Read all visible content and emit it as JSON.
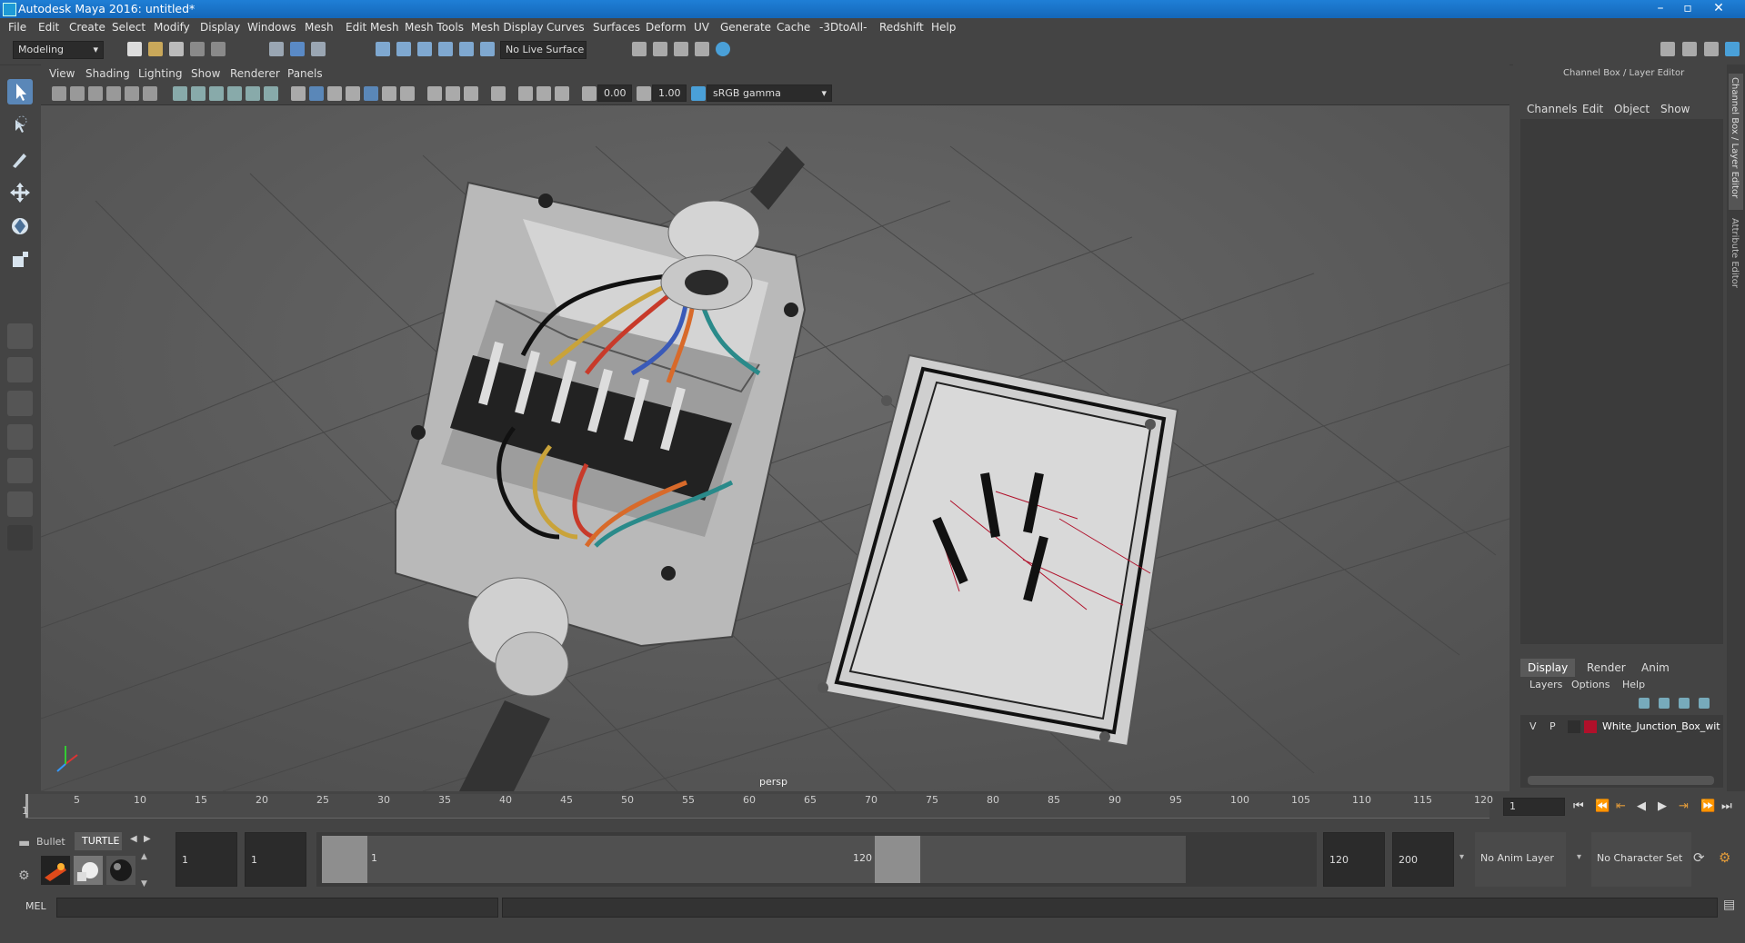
{
  "window": {
    "title": "Autodesk Maya 2016: untitled*"
  },
  "menubar": [
    "File",
    "Edit",
    "Create",
    "Select",
    "Modify",
    "Display",
    "Windows",
    "Mesh",
    "Edit Mesh",
    "Mesh Tools",
    "Mesh Display",
    "Curves",
    "Surfaces",
    "Deform",
    "UV",
    "Generate",
    "Cache",
    "-3DtoAll-",
    "Redshift",
    "Help"
  ],
  "shelf": {
    "mode": "Modeling",
    "live_surface": "No Live Surface"
  },
  "viewport": {
    "menu": [
      "View",
      "Shading",
      "Lighting",
      "Show",
      "Renderer",
      "Panels"
    ],
    "exposure": "0.00",
    "gamma": "1.00",
    "color_space": "sRGB gamma",
    "camera_label": "persp"
  },
  "channel_box": {
    "header": "Channel Box / Layer Editor",
    "menu": [
      "Channels",
      "Edit",
      "Object",
      "Show"
    ],
    "side_tabs": [
      "Channel Box / Layer Editor",
      "Attribute Editor"
    ]
  },
  "layer_editor": {
    "tabs": [
      "Display",
      "Render",
      "Anim"
    ],
    "menu": [
      "Layers",
      "Options",
      "Help"
    ],
    "layer": {
      "visible": "V",
      "playback": "P",
      "name": "White_Junction_Box_wit",
      "color": "#b0102a"
    }
  },
  "timeline": {
    "ticks": [
      "5",
      "10",
      "15",
      "20",
      "25",
      "30",
      "35",
      "40",
      "45",
      "50",
      "55",
      "60",
      "65",
      "70",
      "75",
      "80",
      "85",
      "90",
      "95",
      "100",
      "105",
      "110",
      "115",
      "120"
    ],
    "start_tick": "1",
    "current_frame": "1"
  },
  "range": {
    "shelf_tabs": [
      "Bullet",
      "TURTLE"
    ],
    "start_field": "1",
    "playback_start": "1",
    "slider_start": "1",
    "slider_end": "120",
    "playback_end": "120",
    "end_field": "200",
    "anim_layer": "No Anim Layer",
    "character_set": "No Character Set"
  },
  "command_line": {
    "label": "MEL"
  }
}
